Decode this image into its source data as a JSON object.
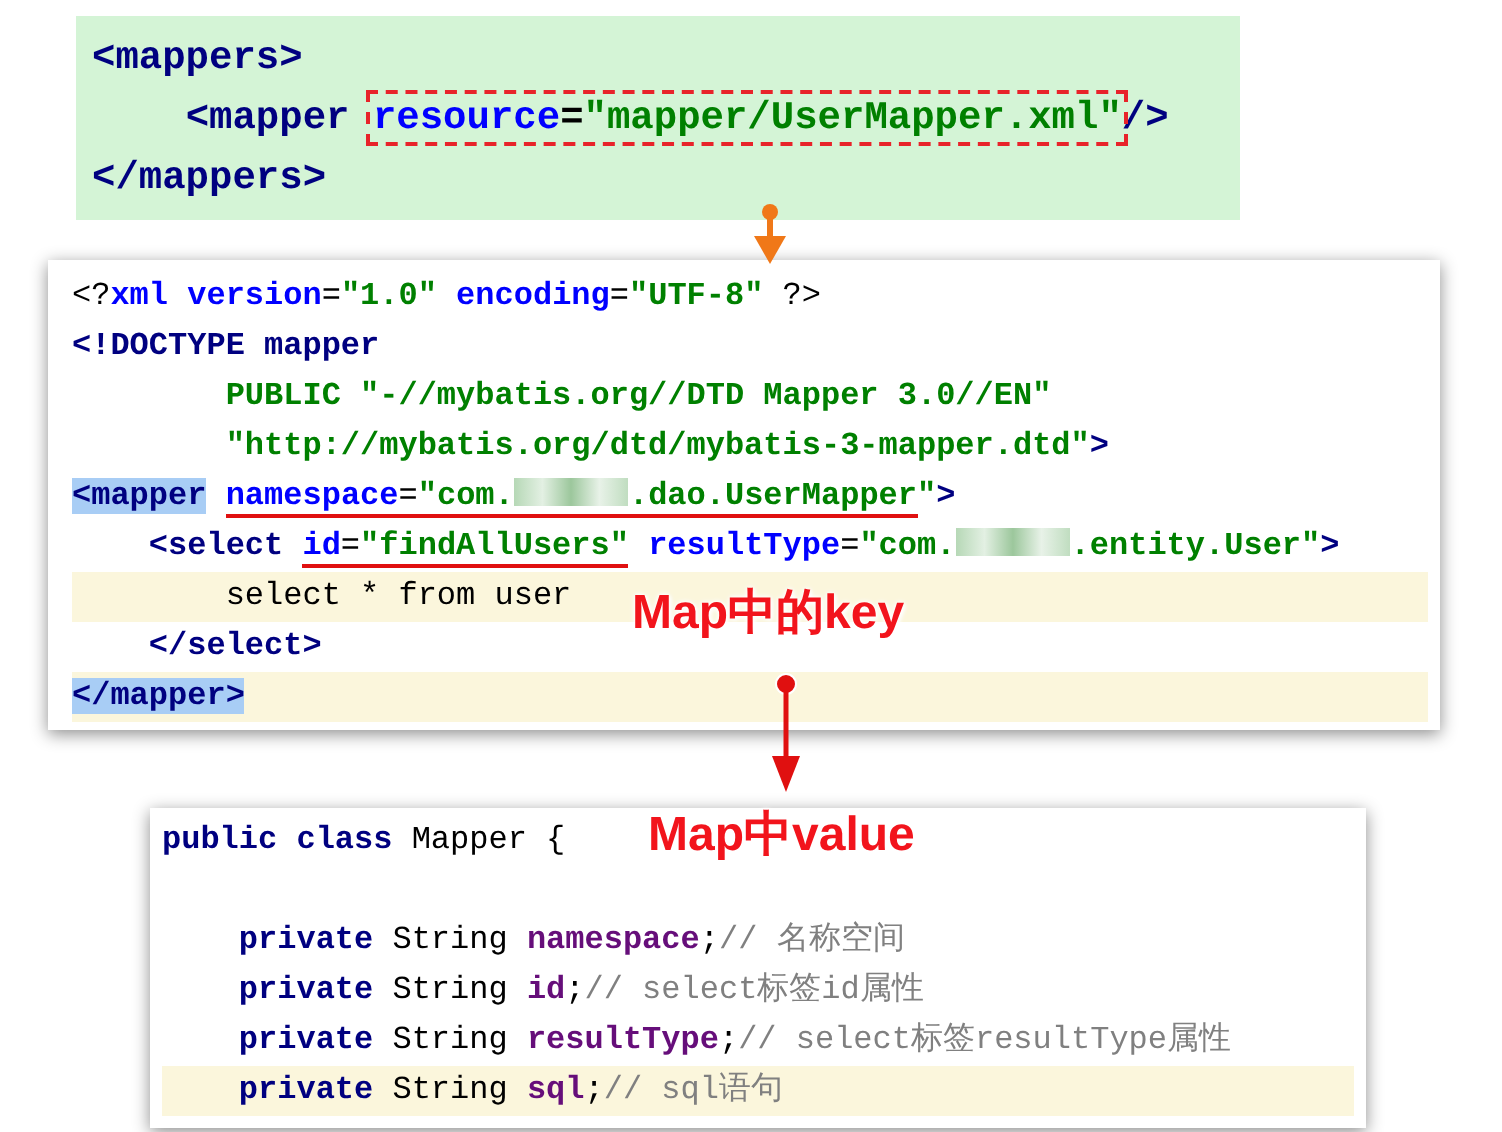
{
  "config_snippet": {
    "lines": [
      {
        "tokens": [
          {
            "kind": "tag",
            "text": "<mappers>"
          }
        ]
      },
      {
        "tokens": [
          {
            "kind": "tag",
            "text": "    <mapper "
          },
          {
            "kind": "attr",
            "text": "resource",
            "boxed": true
          },
          {
            "kind": "plain",
            "text": "=",
            "boxed": true
          },
          {
            "kind": "value",
            "text": "\"mapper/UserMapper.xml\"",
            "boxed": true
          },
          {
            "kind": "tag",
            "text": "/>"
          }
        ]
      },
      {
        "tokens": [
          {
            "kind": "tag",
            "text": "</mappers>"
          }
        ]
      }
    ]
  },
  "mapper_xml": {
    "lines": [
      {
        "highlighted": false,
        "tokens": [
          {
            "kind": "plain",
            "text": "<?"
          },
          {
            "kind": "attr",
            "text": "xml version"
          },
          {
            "kind": "plain",
            "text": "="
          },
          {
            "kind": "value",
            "text": "\"1.0\""
          },
          {
            "kind": "attr",
            "text": " encoding"
          },
          {
            "kind": "plain",
            "text": "="
          },
          {
            "kind": "value",
            "text": "\"UTF-8\""
          },
          {
            "kind": "plain",
            "text": " ?>"
          }
        ]
      },
      {
        "highlighted": false,
        "tokens": [
          {
            "kind": "tag",
            "text": "<!DOCTYPE mapper"
          }
        ]
      },
      {
        "highlighted": false,
        "tokens": [
          {
            "kind": "value",
            "text": "        PUBLIC \"-//mybatis.org//DTD Mapper 3.0//EN\""
          }
        ]
      },
      {
        "highlighted": false,
        "tokens": [
          {
            "kind": "value",
            "text": "        \"http://mybatis.org/dtd/mybatis-3-mapper.dtd\""
          },
          {
            "kind": "tag",
            "text": ">"
          }
        ]
      },
      {
        "highlighted": false,
        "tokens": [
          {
            "kind": "tag",
            "text": "<mapper",
            "matched": true
          },
          {
            "kind": "attr",
            "text": " namespace",
            "underlined": true
          },
          {
            "kind": "plain",
            "text": "=",
            "underlined": true
          },
          {
            "kind": "value",
            "text": "\"com.",
            "underlined": true
          },
          {
            "kind": "redacted",
            "underlined": true
          },
          {
            "kind": "value",
            "text": ".dao.UserMapper",
            "underlined": true
          },
          {
            "kind": "value",
            "text": "\""
          },
          {
            "kind": "tag",
            "text": ">"
          }
        ]
      },
      {
        "highlighted": false,
        "tokens": [
          {
            "kind": "tag",
            "text": "    <select "
          },
          {
            "kind": "attr",
            "text": "id",
            "underlined": true
          },
          {
            "kind": "plain",
            "text": "=",
            "underlined": true
          },
          {
            "kind": "value",
            "text": "\"findAllUsers\"",
            "underlined": true
          },
          {
            "kind": "attr",
            "text": " resultType"
          },
          {
            "kind": "plain",
            "text": "="
          },
          {
            "kind": "value",
            "text": "\"com."
          },
          {
            "kind": "redacted"
          },
          {
            "kind": "value",
            "text": ".entity.User\""
          },
          {
            "kind": "tag",
            "text": ">"
          }
        ]
      },
      {
        "highlighted": true,
        "tokens": [
          {
            "kind": "text",
            "text": "        select * from user"
          }
        ]
      },
      {
        "highlighted": false,
        "tokens": [
          {
            "kind": "tag",
            "text": "    </select>"
          }
        ]
      },
      {
        "highlighted": true,
        "tokens": [
          {
            "kind": "tag",
            "text": "</mapper>",
            "matched": true
          }
        ]
      }
    ],
    "annotation": "Map中的key"
  },
  "java_class": {
    "lines": [
      {
        "highlighted": false,
        "tokens": [
          {
            "kind": "keyword",
            "text": "public class"
          },
          {
            "kind": "text",
            "text": " Mapper {"
          }
        ]
      },
      {
        "highlighted": false,
        "tokens": [
          {
            "kind": "keyword",
            "text": "    private"
          },
          {
            "kind": "text",
            "text": " String "
          },
          {
            "kind": "field",
            "text": "namespace"
          },
          {
            "kind": "text",
            "text": ";"
          },
          {
            "kind": "comment",
            "text": "// 名称空间"
          }
        ]
      },
      {
        "highlighted": false,
        "tokens": [
          {
            "kind": "keyword",
            "text": "    private"
          },
          {
            "kind": "text",
            "text": " String "
          },
          {
            "kind": "field",
            "text": "id"
          },
          {
            "kind": "text",
            "text": ";"
          },
          {
            "kind": "comment",
            "text": "// select标签id属性"
          }
        ]
      },
      {
        "highlighted": false,
        "tokens": [
          {
            "kind": "keyword",
            "text": "    private"
          },
          {
            "kind": "text",
            "text": " String "
          },
          {
            "kind": "field",
            "text": "resultType"
          },
          {
            "kind": "text",
            "text": ";"
          },
          {
            "kind": "comment",
            "text": "// select标签resultType属性"
          }
        ]
      },
      {
        "highlighted": true,
        "tokens": [
          {
            "kind": "keyword",
            "text": "    private"
          },
          {
            "kind": "text",
            "text": " String "
          },
          {
            "kind": "field",
            "text": "sql"
          },
          {
            "kind": "text",
            "text": ";"
          },
          {
            "kind": "comment",
            "text": "// sql语句"
          }
        ]
      }
    ],
    "annotation": "Map中value"
  }
}
